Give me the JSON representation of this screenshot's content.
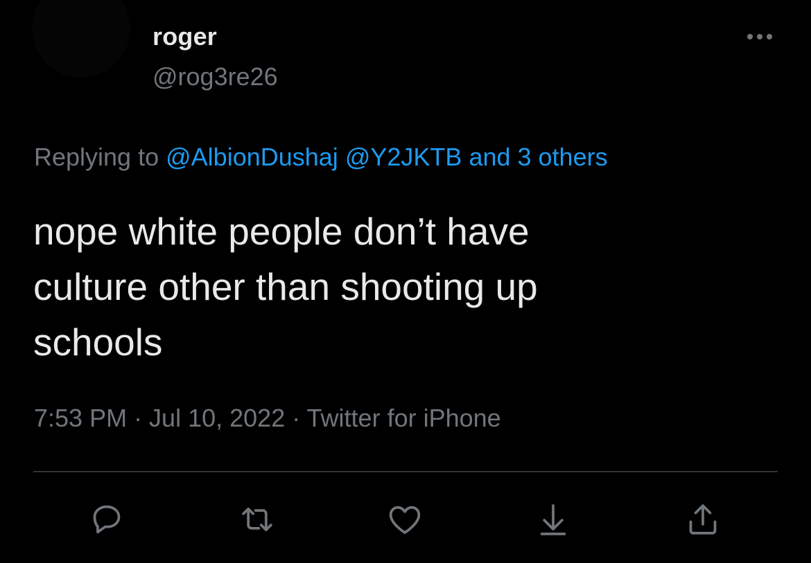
{
  "tweet": {
    "display_name": "roger",
    "handle": "@rog3re26",
    "replying": {
      "prefix": "Replying to",
      "mention_1": "@AlbionDushaj",
      "mention_2": "@Y2JKTB",
      "others": "and 3 others"
    },
    "text": "nope white people don’t have\nculture other than shooting up\nschools",
    "meta": "7:53 PM · Jul 10, 2022 · Twitter for iPhone"
  },
  "actions": [
    {
      "name": "reply-icon"
    },
    {
      "name": "retweet-icon"
    },
    {
      "name": "like-icon"
    },
    {
      "name": "bookmark-icon"
    },
    {
      "name": "share-icon"
    }
  ],
  "colors": {
    "background": "#000000",
    "primary_text": "#e7e9ea",
    "secondary_text": "#71767b",
    "link": "#1d9bf0",
    "divider": "#2f3336"
  }
}
